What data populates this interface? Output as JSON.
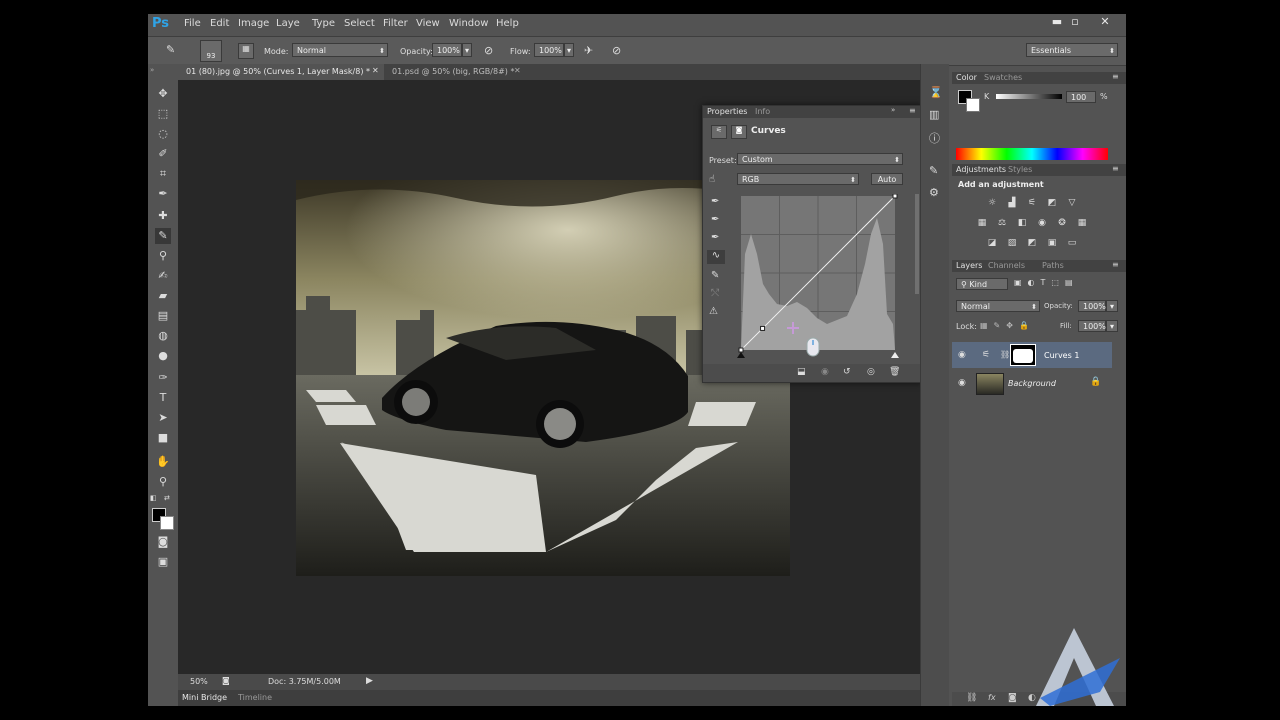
{
  "app": {
    "logo": "Ps"
  },
  "menu": [
    "File",
    "Edit",
    "Image",
    "Laye",
    "Type",
    "Select",
    "Filter",
    "View",
    "Window",
    "Help"
  ],
  "window_controls": {
    "minimize": "▬",
    "maximize": "▫",
    "close": "✕"
  },
  "options_bar": {
    "brush_size": "93",
    "mode_label": "Mode:",
    "mode_value": "Normal",
    "opacity_label": "Opacity:",
    "opacity_value": "100%",
    "flow_label": "Flow:",
    "flow_value": "100%",
    "workspace": "Essentials"
  },
  "document_tabs": [
    {
      "label": "01 (80).jpg @ 50% (Curves 1, Layer Mask/8) *",
      "active": true
    },
    {
      "label": "01.psd @ 50% (big, RGB/8#) *",
      "active": false
    }
  ],
  "status_bar": {
    "zoom": "50%",
    "doc": "Doc: 3.75M/5.00M"
  },
  "bottom_tabs": [
    "Mini Bridge",
    "Timeline"
  ],
  "properties_panel": {
    "tabs": [
      "Properties",
      "Info"
    ],
    "title": "Curves",
    "preset_label": "Preset:",
    "preset_value": "Custom",
    "channel_value": "RGB",
    "auto_button": "Auto",
    "curve_points": [
      [
        0,
        0
      ],
      [
        0.14,
        0.14
      ],
      [
        1,
        1
      ]
    ]
  },
  "color_panel": {
    "tabs": [
      "Color",
      "Swatches"
    ],
    "channel": "K",
    "value": "100",
    "unit": "%"
  },
  "adjustments_panel": {
    "tabs": [
      "Adjustments",
      "Styles"
    ],
    "heading": "Add an adjustment"
  },
  "layers_panel": {
    "tabs": [
      "Layers",
      "Channels",
      "Paths"
    ],
    "kind": "Kind",
    "blend_mode": "Normal",
    "opacity_label": "Opacity:",
    "opacity_value": "100%",
    "lock_label": "Lock:",
    "fill_label": "Fill:",
    "fill_value": "100%",
    "layers": [
      {
        "name": "Curves 1",
        "selected": true
      },
      {
        "name": "Background",
        "selected": false
      }
    ]
  },
  "colors": {
    "chrome": "#535353",
    "canvas_bg": "#282828",
    "accent": "#2fa3e6",
    "selected_layer": "#5b6a80"
  }
}
